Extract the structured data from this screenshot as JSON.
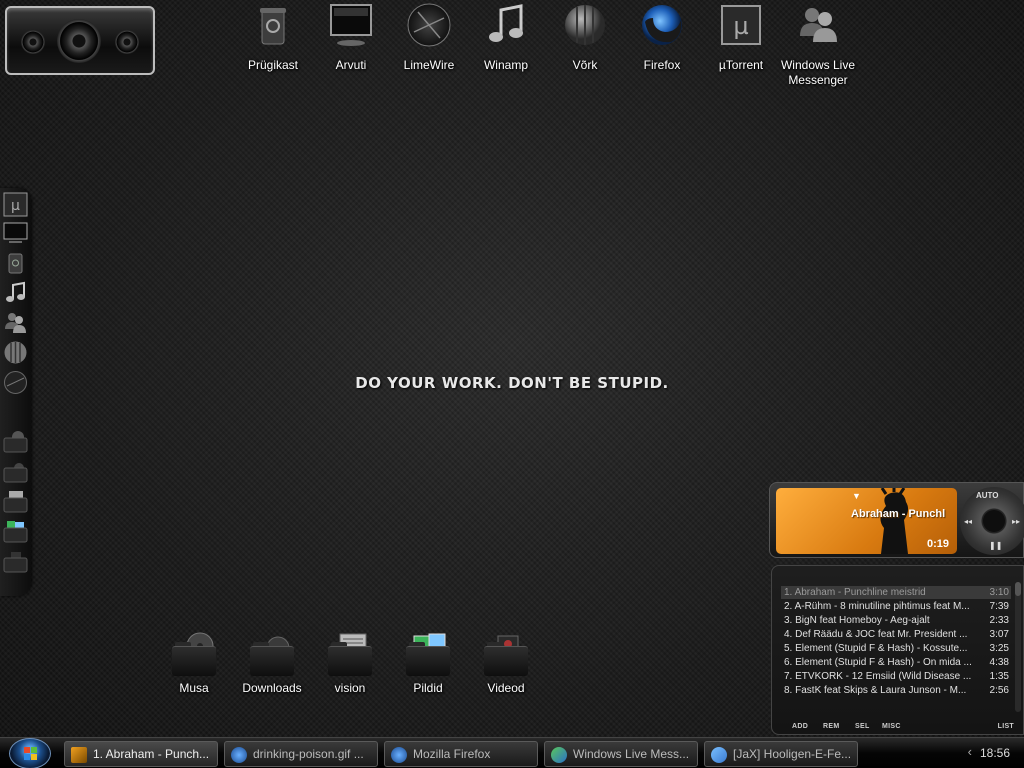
{
  "desktop": {
    "motto": "DO YOUR WORK. DON'T BE STUPID.",
    "top_icons": [
      {
        "label": "Prügikast",
        "icon": "recycle-bin-icon"
      },
      {
        "label": "Arvuti",
        "icon": "computer-monitor-icon"
      },
      {
        "label": "LimeWire",
        "icon": "limewire-icon"
      },
      {
        "label": "Winamp",
        "icon": "winamp-note-icon"
      },
      {
        "label": "Võrk",
        "icon": "network-globe-icon"
      },
      {
        "label": "Firefox",
        "icon": "firefox-icon"
      },
      {
        "label": "µTorrent",
        "icon": "utorrent-icon"
      },
      {
        "label": "Windows Live Messenger",
        "icon": "messenger-people-icon"
      }
    ],
    "folders": [
      {
        "label": "Musa",
        "icon": "music-folder-icon"
      },
      {
        "label": "Downloads",
        "icon": "downloads-folder-icon"
      },
      {
        "label": "vision",
        "icon": "vision-folder-icon"
      },
      {
        "label": "Pildid",
        "icon": "pictures-folder-icon"
      },
      {
        "label": "Videod",
        "icon": "videos-folder-icon"
      }
    ],
    "dock_items": [
      "utorrent-icon",
      "computer-monitor-icon",
      "recycle-bin-icon",
      "winamp-note-icon",
      "messenger-people-icon",
      "network-globe-icon",
      "limewire-icon",
      "music-folder-icon",
      "downloads-folder-icon",
      "vision-folder-icon",
      "pictures-folder-icon",
      "videos-folder-icon"
    ]
  },
  "player": {
    "now_playing": "Abraham - Punchl",
    "time": "0:19",
    "auto_label": "AUTO",
    "accent": "#e8901c",
    "playlist": [
      {
        "title": "1. Abraham - Punchline meistrid",
        "duration": "3:10"
      },
      {
        "title": "2. A-Rühm - 8 minutiline pihtimus feat M...",
        "duration": "7:39"
      },
      {
        "title": "3. BigN feat Homeboy - Aeg-ajalt",
        "duration": "2:33"
      },
      {
        "title": "4. Def Räädu & JOC feat Mr. President ...",
        "duration": "3:07"
      },
      {
        "title": "5. Element (Stupid F & Hash) - Kossute...",
        "duration": "3:25"
      },
      {
        "title": "6. Element (Stupid F & Hash) - On mida ...",
        "duration": "4:38"
      },
      {
        "title": "7. ETVKORK - 12 Emsiid (Wild Disease ...",
        "duration": "1:35"
      },
      {
        "title": "8. FastK feat Skips & Laura Junson - M...",
        "duration": "2:56"
      }
    ],
    "buttons": {
      "add": "ADD",
      "rem": "REM",
      "sel": "SEL",
      "misc": "MISC",
      "list": "LIST"
    }
  },
  "taskbar": {
    "tasks": [
      {
        "label": "1. Abraham - Punch...",
        "icon": "winamp-icon"
      },
      {
        "label": "drinking-poison.gif ...",
        "icon": "firefox-icon"
      },
      {
        "label": "Mozilla Firefox",
        "icon": "firefox-icon"
      },
      {
        "label": "Windows Live Mess...",
        "icon": "messenger-icon"
      },
      {
        "label": "[JaX] Hooligen-E-Fe...",
        "icon": "messenger-chat-icon"
      }
    ],
    "clock": "18:56"
  }
}
